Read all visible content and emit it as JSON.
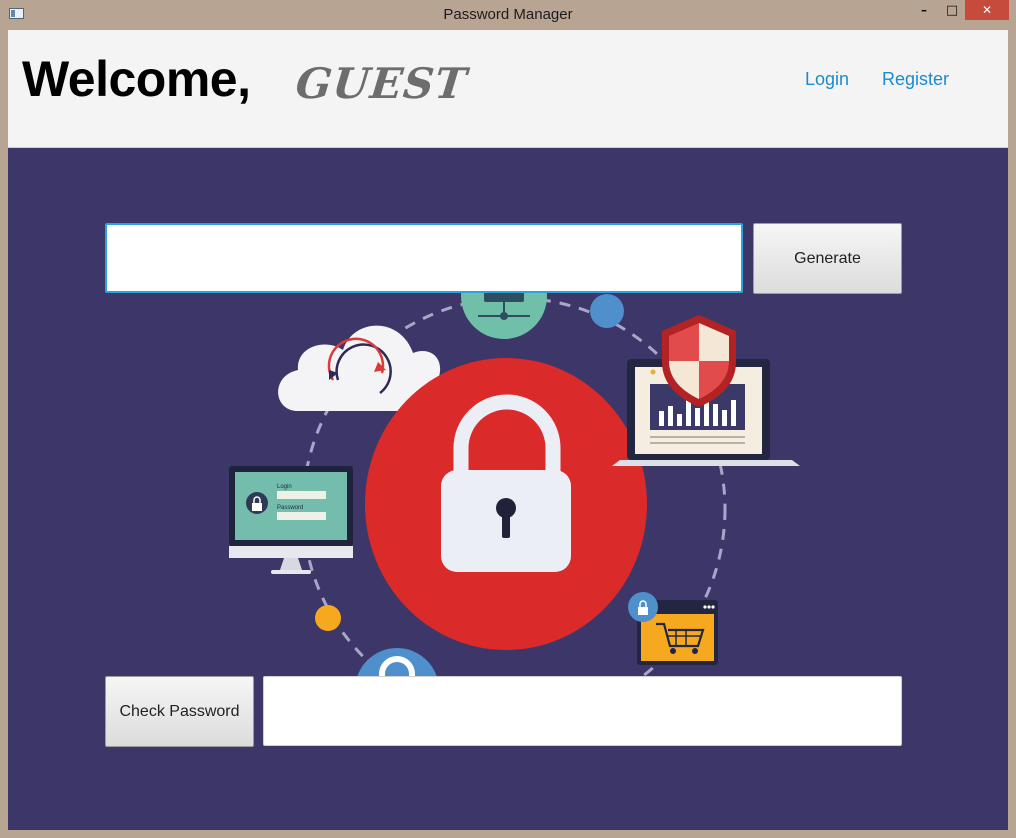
{
  "window": {
    "title": "Password Manager",
    "controls": {
      "minimize": "–",
      "maximize": "□",
      "close": "✕"
    }
  },
  "header": {
    "welcome": "Welcome,",
    "user": "GUEST",
    "nav": {
      "login": "Login",
      "register": "Register"
    }
  },
  "generator": {
    "input_value": "",
    "button_label": "Generate"
  },
  "checker": {
    "button_label": "Check Password",
    "input_value": ""
  },
  "illustration": {
    "monitor_login_label": "Login",
    "monitor_password_label": "Password"
  },
  "colors": {
    "background": "#3d3769",
    "header_bg": "#f4f4f4",
    "link": "#1b8bcf",
    "lock_circle": "#db2a2a",
    "input_focus": "#2aa3e0"
  }
}
